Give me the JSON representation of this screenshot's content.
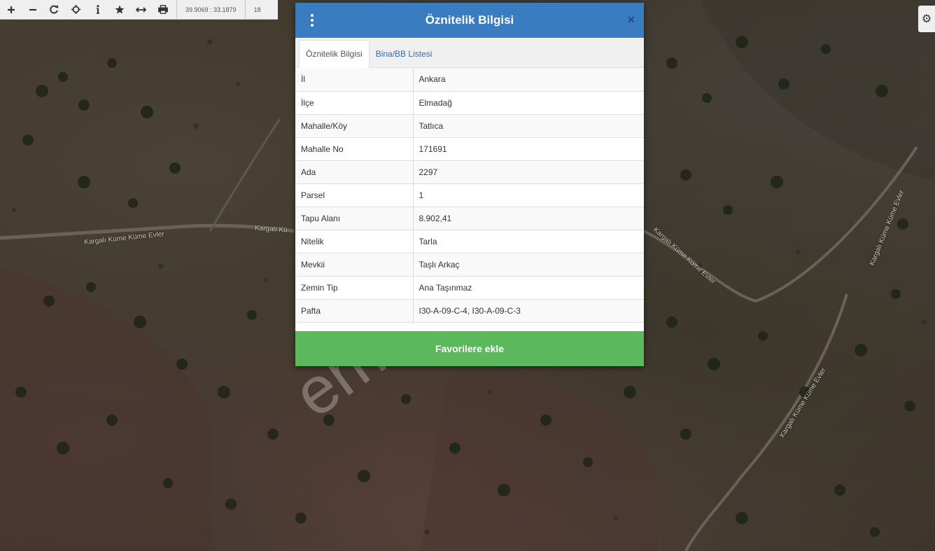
{
  "toolbar": {
    "coordinates": "39.9069 : 33.1879",
    "zoom_level": "18",
    "buttons": [
      "zoom-in",
      "zoom-out",
      "refresh",
      "locate",
      "info",
      "favorite",
      "measure",
      "print"
    ]
  },
  "map": {
    "road_labels": [
      "Kargalı Küme Küme Evler",
      "Kargalı Kü",
      "Kargalı Küme Küme Evler",
      "Kargalı Küme Küme Evler",
      "Kargalı Küme Küme Evler"
    ]
  },
  "modal": {
    "title": "Öznitelik Bilgisi",
    "close_label": "×",
    "tabs": [
      {
        "label": "Öznitelik Bilgisi",
        "active": true
      },
      {
        "label": "Bina/BB Listesi",
        "active": false
      }
    ],
    "rows": [
      {
        "key": "İl",
        "value": "Ankara"
      },
      {
        "key": "İlçe",
        "value": "Elmadağ"
      },
      {
        "key": "Mahalle/Köy",
        "value": "Tatlıca"
      },
      {
        "key": "Mahalle No",
        "value": "171691"
      },
      {
        "key": "Ada",
        "value": "2297"
      },
      {
        "key": "Parsel",
        "value": "1"
      },
      {
        "key": "Tapu Alanı",
        "value": "8.902,41"
      },
      {
        "key": "Nitelik",
        "value": "Tarla"
      },
      {
        "key": "Mevkii",
        "value": "Taşlı Arkaç"
      },
      {
        "key": "Zemin Tip",
        "value": "Ana Taşınmaz"
      },
      {
        "key": "Pafta",
        "value": "I30-A-09-C-4, I30-A-09-C-3"
      }
    ],
    "favorite_button": "Favorilere ekle"
  },
  "watermark": "emlakjet.com",
  "settings_icon": "gear-icon"
}
